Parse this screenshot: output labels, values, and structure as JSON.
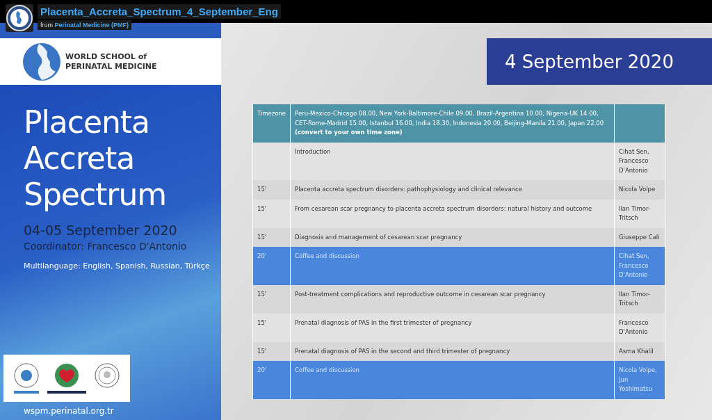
{
  "player": {
    "title": "Placenta_Accreta_Spectrum_4_September_Eng",
    "byline_prefix": "from",
    "channel": "Perinatal Medicine (PMF)"
  },
  "slide": {
    "school_name": [
      "WORLD SCHOOL of",
      "PERINATAL MEDICINE"
    ],
    "course_title": [
      "Placenta",
      "Accreta",
      "Spectrum"
    ],
    "dates": "04-05 September 2020",
    "coordinator": "Coordinator: Francesco D'Antonio",
    "languages": "Multilanguage: English, Spanish, Russian, Türkçe",
    "website": "wspm.perinatal.org.tr",
    "day_banner": "4 September 2020",
    "schedule": [
      {
        "kind": "header",
        "time": "Timezone",
        "topic": "Peru-Mexico-Chicago 08.00, New York-Baltimore-Chile 09.00, Brazil-Argentina 10.00, Nigeria-UK 14.00, CET-Rome-Madrid 15.00, Istanbul 16.00, India 18.30, Indonesia 20.00, Beijing-Manila 21.00, Japan 22.00 **(convert to your own time zone)**"
      },
      {
        "kind": "talk",
        "topic": "Introduction",
        "speaker": "Cihat Sen, Francesco D'Antonio"
      },
      {
        "kind": "talk",
        "time": "15'",
        "topic": "Placenta accreta spectrum disorders: pathophysiology and clinical relevance",
        "speaker": "Nicola Volpe"
      },
      {
        "kind": "talk",
        "time": "15'",
        "topic": "From cesarean scar pregnancy to placenta accreta spectrum disorders: natural history and outcome",
        "speaker": "Ilan Timor-Tritsch"
      },
      {
        "kind": "talk",
        "time": "15'",
        "topic": "Diagnosis and management of cesarean scar pregnancy",
        "speaker": "Giuseppe Cali"
      },
      {
        "kind": "break",
        "time": "20'",
        "topic": "Coffee and discussion",
        "speaker": "Cihat Sen, Francesco D'Antonio"
      },
      {
        "kind": "talk",
        "time": "15'",
        "topic": "Post-treatment complications and reproductive outcome in cesarean scar pregnancy",
        "speaker": "Ilan Timor-Tritsch"
      },
      {
        "kind": "talk",
        "time": "15'",
        "topic": "Prenatal diagnosis of PAS in the first trimester of pregnancy",
        "speaker": "Francesco D'Antonio"
      },
      {
        "kind": "talk",
        "time": "15'",
        "topic": "Prenatal diagnosis of PAS in the second and third trimester of pregnancy",
        "speaker": "Asma Khalil"
      },
      {
        "kind": "break",
        "time": "20'",
        "topic": "Coffee and discussion",
        "speaker": "Nicola Volpe, Jun Yoshimatsu"
      }
    ]
  }
}
